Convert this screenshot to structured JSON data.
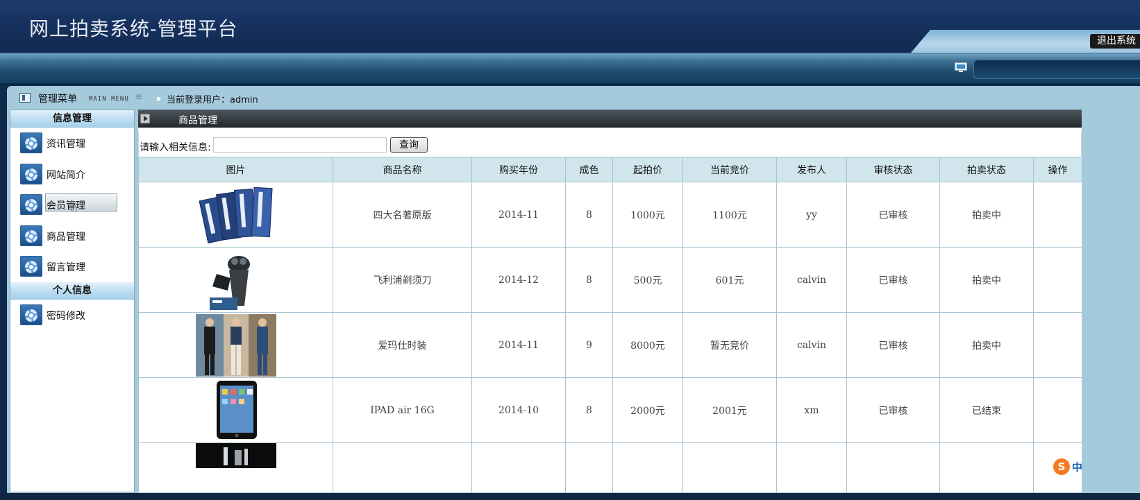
{
  "header": {
    "title": "网上拍卖系统-管理平台",
    "logout_label": "退出系统"
  },
  "topbar": {
    "menu_title": "管理菜单",
    "menu_subtitle": "MAIN MENU",
    "current_user_label": "当前登录用户：admin"
  },
  "sidebar": {
    "sections": [
      {
        "title": "信息管理",
        "items": [
          "资讯管理",
          "网站简介",
          "会员管理",
          "商品管理",
          "留言管理"
        ]
      },
      {
        "title": "个人信息",
        "items": [
          "密码修改"
        ]
      }
    ],
    "hovered_item": "会员管理"
  },
  "panel": {
    "title": "商品管理"
  },
  "search": {
    "label": "请输入相关信息:",
    "value": "",
    "button_label": "查询"
  },
  "table": {
    "headers": [
      "图片",
      "商品名称",
      "购买年份",
      "成色",
      "起拍价",
      "当前竞价",
      "发布人",
      "审核状态",
      "拍卖状态",
      "操作"
    ],
    "rows": [
      {
        "image": "books-photo",
        "name": "四大名著原版",
        "year": "2014-11",
        "condition": "8",
        "start_price": "1000元",
        "current_bid": "1100元",
        "publisher": "yy",
        "review": "已审核",
        "auction": "拍卖中",
        "action": ""
      },
      {
        "image": "shaver-photo",
        "name": "飞利浦剃须刀",
        "year": "2014-12",
        "condition": "8",
        "start_price": "500元",
        "current_bid": "601元",
        "publisher": "calvin",
        "review": "已审核",
        "auction": "拍卖中",
        "action": ""
      },
      {
        "image": "fashion-photo",
        "name": "爱玛仕时装",
        "year": "2014-11",
        "condition": "9",
        "start_price": "8000元",
        "current_bid": "暂无竞价",
        "publisher": "calvin",
        "review": "已审核",
        "auction": "拍卖中",
        "action": ""
      },
      {
        "image": "ipad-photo",
        "name": "IPAD air 16G",
        "year": "2014-10",
        "condition": "8",
        "start_price": "2000元",
        "current_bid": "2001元",
        "publisher": "xm",
        "review": "已审核",
        "auction": "已结束",
        "action": ""
      },
      {
        "image": "dark-product-photo",
        "name": "",
        "year": "",
        "condition": "",
        "start_price": "",
        "current_bid": "",
        "publisher": "",
        "review": "",
        "auction": "",
        "action": ""
      }
    ]
  },
  "ime": {
    "logo": "S",
    "mode": "中"
  }
}
